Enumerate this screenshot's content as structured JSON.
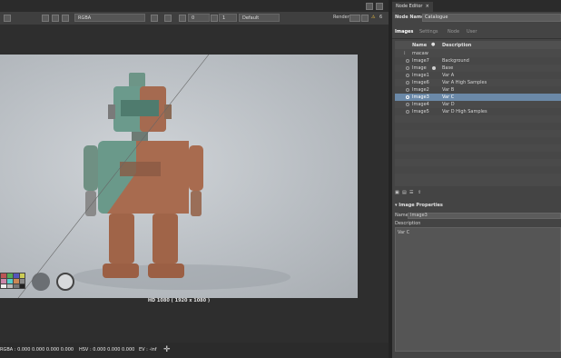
{
  "viewer": {
    "channel_select": "RGBA",
    "exposure_value": "0",
    "gamma_value": "1",
    "lut_select": "Default",
    "render_label": "Render",
    "warning_count": "6",
    "resolution_label": "HD 1080 ( 1920 x 1080 )",
    "status": {
      "rgba": "RGBA : 0.000 0.000 0.000 0.000",
      "hsv": "HSV : 0.000 0.000 0.000",
      "ev": "EV : -inf"
    }
  },
  "panel": {
    "tab_title": "Node Editor",
    "node_name_label": "Node Name",
    "node_name_value": "Catalogue",
    "tabs": [
      "Images",
      "Settings",
      "Node",
      "User"
    ],
    "list_headers": {
      "name": "Name",
      "description": "Description"
    },
    "rows": [
      {
        "name": "macaw",
        "description": "",
        "selected": false
      },
      {
        "name": "Image7",
        "description": "Background",
        "selected": false
      },
      {
        "name": "Image",
        "description": "Base",
        "selected": false
      },
      {
        "name": "Image1",
        "description": "Var A",
        "selected": false
      },
      {
        "name": "Image6",
        "description": "Var A High Samples",
        "selected": false
      },
      {
        "name": "Image2",
        "description": "Var B",
        "selected": false
      },
      {
        "name": "Image3",
        "description": "Var C",
        "selected": true
      },
      {
        "name": "Image4",
        "description": "Var D",
        "selected": false
      },
      {
        "name": "Image5",
        "description": "Var D High Samples",
        "selected": false
      }
    ],
    "properties_title": "Image Properties",
    "name_label": "Name",
    "name_value": "Image3",
    "description_label": "Description",
    "description_value": "Var C"
  },
  "colors": {
    "selection": "#6b89a8",
    "background": "#444444"
  }
}
